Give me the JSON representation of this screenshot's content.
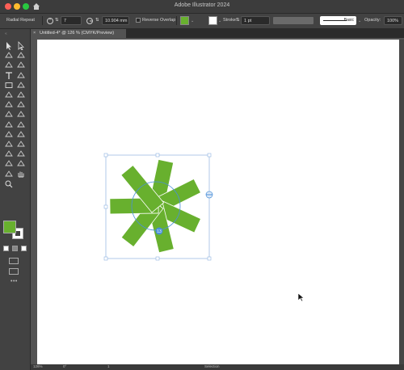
{
  "app": {
    "title": "Adobe Illustrator 2024"
  },
  "control_bar": {
    "object_label": "Radial Repeat",
    "instances_value": "7",
    "radius_value": "10.904 mm",
    "reverse_overlap_label": "Reverse Overlap",
    "stroke_label": "Stroke:",
    "stroke_value": "1 pt",
    "brush_label": "Basic",
    "opacity_label": "Opacity:",
    "opacity_value": "100%"
  },
  "document_tab": {
    "title": "Untitled-4* @ 126 % (CMYK/Preview)",
    "close_glyph": "×"
  },
  "status_bar": {
    "zoom": "126%",
    "angle": "0°",
    "page": "1",
    "tool": "Selection"
  },
  "colors": {
    "fill": "#68b02e",
    "stroke": "#ffffff",
    "selection": "#4a90d9",
    "ui_dark": "#323232"
  },
  "selection": {
    "instance_count_badge": "13"
  },
  "toolbar": {
    "tools": [
      "selection-tool",
      "direct-selection-tool",
      "magic-wand-tool",
      "lasso-tool",
      "pen-tool",
      "curvature-tool",
      "type-tool",
      "line-tool",
      "rectangle-tool",
      "paintbrush-tool",
      "shaper-tool",
      "eraser-tool",
      "rotate-tool",
      "scale-tool",
      "width-tool",
      "free-transform-tool",
      "shape-builder-tool",
      "live-paint-tool",
      "perspective-grid-tool",
      "mesh-tool",
      "gradient-tool",
      "eyedropper-tool",
      "blend-tool",
      "symbol-sprayer-tool",
      "column-graph-tool",
      "artboard-tool",
      "slice-tool",
      "hand-tool",
      "zoom-tool"
    ]
  }
}
